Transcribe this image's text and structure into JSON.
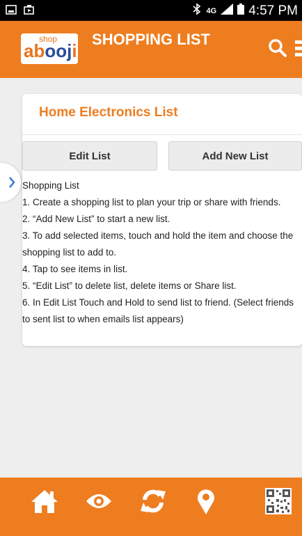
{
  "status_bar": {
    "network": "4G",
    "time": "4:57 PM"
  },
  "app_bar": {
    "logo_shop": "shop",
    "logo_name_orange_1": "ab",
    "logo_name_blue": "ooj",
    "logo_name_orange_2": "i",
    "title": "SHOPPING LIST"
  },
  "list_card": {
    "title": "Home Electronics List",
    "edit_label": "Edit List",
    "add_label": "Add New List",
    "instructions_heading": "Shopping List",
    "instructions": [
      "1. Create a shopping list to plan your trip or share with friends.",
      "2. “Add New List” to start a new list.",
      "3. To add selected items, touch and hold the item and choose the shopping list to add to.",
      "4. Tap to see items in list.",
      "5. “Edit List” to delete list, delete items or Share list.",
      "6. In Edit List Touch and Hold to send list to friend. (Select friends to sent list to when emails list appears)"
    ]
  },
  "bottom_nav": {
    "items": [
      "home-icon",
      "eye-icon",
      "refresh-icon",
      "location-icon",
      "qr-code-icon"
    ]
  },
  "colors": {
    "accent": "#ee7d20",
    "brand_blue": "#2a4c9a",
    "background": "#eeeeee"
  }
}
